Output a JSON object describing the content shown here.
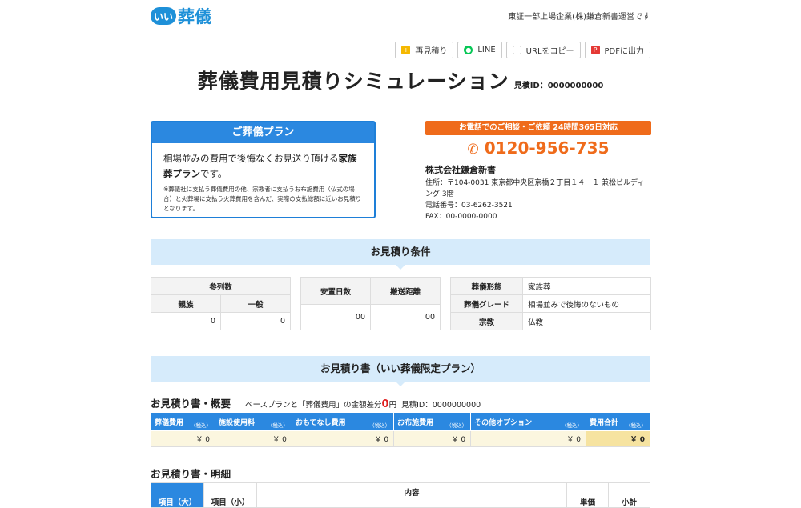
{
  "header": {
    "logo_mark": "いい",
    "logo_text": "葬儀",
    "right_text": "東証一部上場企業(株)鎌倉新書運営です"
  },
  "toolbar": {
    "buttons": [
      {
        "label": "再見積り",
        "icon": "refresh-icon",
        "color": "#f5b800"
      },
      {
        "label": "LINE",
        "icon": "line-icon",
        "color": "#06c755"
      },
      {
        "label": "URLをコピー",
        "icon": "copy-icon",
        "color": "#888888"
      },
      {
        "label": "PDFに出力",
        "icon": "pdf-icon",
        "color": "#e53935"
      }
    ]
  },
  "title": {
    "main": "葬儀費用見積りシミュレーション",
    "estimate_id": "見積ID：0000000000"
  },
  "plan": {
    "heading": "ご葬儀プラン",
    "text_before": "相場並みの費用で後悔なくお見送り頂ける",
    "text_bold": "家族葬プラン",
    "text_after": "です。",
    "note": "※葬儀社に支払う葬儀費用の他、宗教者に支払うお布施費用（仏式の場合）と火葬場に支払う火葬費用を含んだ、実際の支払総額に近いお見積りとなります。"
  },
  "contact": {
    "bar": "お電話でのご相談・ご依頼 24時間365日対応",
    "phone": "0120-956-735",
    "company": "株式会社鎌倉新書",
    "address": "住所：〒104-0031 東京都中央区京橋２丁目１４－１ 兼松ビルディング 3階",
    "tel": "電話番号：03-6262-3521",
    "fax": "FAX：00-0000-0000"
  },
  "conditions": {
    "heading": "お見積り条件",
    "attendees": {
      "header": "参列数",
      "col1": "親族",
      "col2": "一般",
      "val1": "0",
      "val2": "0"
    },
    "transport": {
      "col1": "安置日数",
      "col2": "搬送距離",
      "val1": "00",
      "val2": "00"
    },
    "details": [
      {
        "label": "葬儀形態",
        "value": "家族葬"
      },
      {
        "label": "葬儀グレード",
        "value": "相場並みで後悔のないもの"
      },
      {
        "label": "宗教",
        "value": "仏教"
      }
    ]
  },
  "estimate": {
    "heading": "お見積り書（いい葬儀限定プラン）",
    "overview_title": "お見積り書・概要",
    "diff_text": "ベースプランと「葬儀費用」の金額差分",
    "diff_value": "0",
    "diff_unit": "円",
    "estimate_id": "見積ID：0000000000",
    "tax_label": "（税込）",
    "columns": [
      "葬儀費用",
      "施設使用料",
      "おもてなし費用",
      "お布施費用",
      "その他オプション",
      "費用合計"
    ],
    "values": [
      "￥ 0",
      "￥ 0",
      "￥ 0",
      "￥ 0",
      "￥ 0",
      "￥ 0"
    ],
    "detail_title": "お見積り書・明細",
    "detail_columns": [
      "項目（大）",
      "項目（小）",
      "内容",
      "単価",
      "小計"
    ]
  }
}
